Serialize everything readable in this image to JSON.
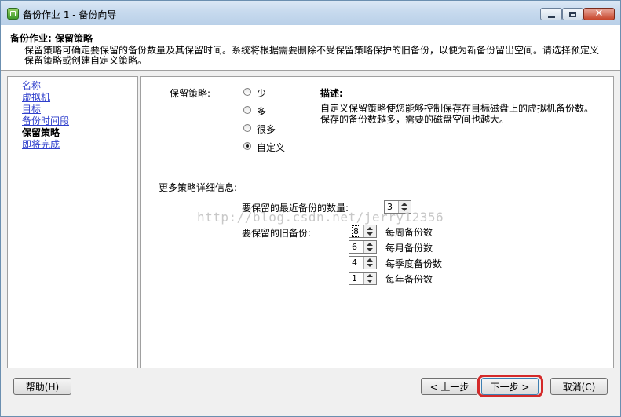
{
  "window": {
    "title": "备份作业 1 - 备份向导"
  },
  "header": {
    "title": "备份作业:  保留策略",
    "description": "保留策略可确定要保留的备份数量及其保留时间。系统将根据需要删除不受保留策略保护的旧备份，以便为新备份留出空间。请选择预定义保留策略或创建自定义策略。"
  },
  "sidebar": {
    "items": [
      {
        "label": "名称",
        "state": "link"
      },
      {
        "label": "虚拟机",
        "state": "link"
      },
      {
        "label": "目标",
        "state": "link"
      },
      {
        "label": "备份时间段",
        "state": "link"
      },
      {
        "label": "保留策略",
        "state": "current"
      },
      {
        "label": "即将完成",
        "state": "link"
      }
    ]
  },
  "policy": {
    "label": "保留策略:",
    "options": [
      {
        "label": "少",
        "checked": false
      },
      {
        "label": "多",
        "checked": false
      },
      {
        "label": "很多",
        "checked": false
      },
      {
        "label": "自定义",
        "checked": true
      }
    ],
    "description_title": "描述:",
    "description_text": "自定义保留策略使您能够控制保存在目标磁盘上的虚拟机备份数。保存的备份数越多，需要的磁盘空间也越大。"
  },
  "details": {
    "title": "更多策略详细信息:",
    "recent_label": "要保留的最近备份的数量:",
    "recent_value": "3",
    "old_label": "要保留的旧备份:",
    "weekly_value": "8",
    "weekly_label": "每周备份数",
    "monthly_value": "6",
    "monthly_label": "每月备份数",
    "quarterly_value": "4",
    "quarterly_label": "每季度备份数",
    "yearly_value": "1",
    "yearly_label": "每年备份数"
  },
  "watermark": "http://blog.csdn.net/jerry12356",
  "buttons": {
    "help": "帮助(H)",
    "back": "< 上一步",
    "next": "下一步 >",
    "cancel": "取消(C)"
  },
  "colors": {
    "link": "#2f3fcc",
    "highlight": "#d42a2a",
    "titlebar": "#c7daee"
  }
}
